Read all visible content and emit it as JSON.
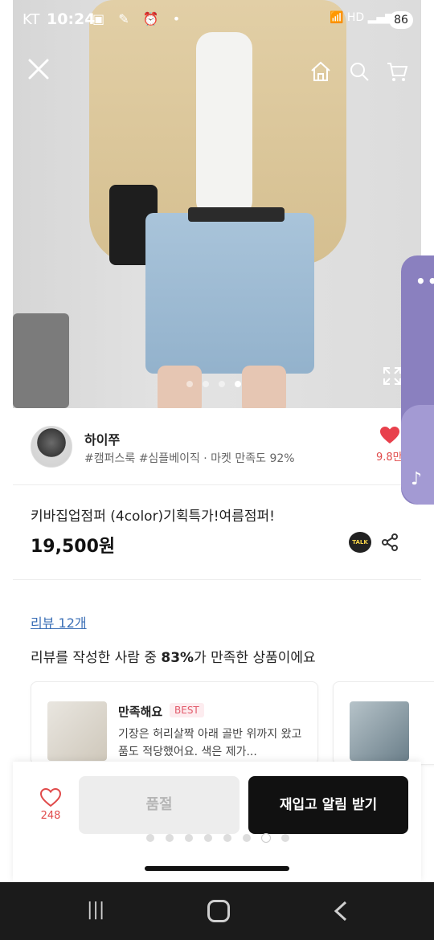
{
  "status_bar": {
    "carrier": "KT",
    "time": "10:24",
    "battery": "86"
  },
  "hero": {
    "image_desc": "product-photo",
    "pager": {
      "total": 4,
      "active": 4
    }
  },
  "seller": {
    "name": "하이쭈",
    "tags": "#캠퍼스룩 #심플베이직 · 마켓 만족도 92%",
    "likes": "9.8만"
  },
  "product": {
    "title": "키바집업점퍼 (4color)기획특가!여름점퍼!",
    "price": "19,500원",
    "talk_label": "TALK"
  },
  "reviews": {
    "link": "리뷰 12개",
    "summary_prefix": "리뷰를 작성한 사람 중 ",
    "summary_percent": "83%",
    "summary_suffix": "가 만족한 상품이에요",
    "cards": [
      {
        "head": "만족해요",
        "badge": "BEST",
        "text": "기장은 허리살짝 아래 골반 위까지 왔고 품도 적당했어요. 색은 제가..."
      }
    ]
  },
  "bottom_bar": {
    "wish_count": "248",
    "soldout_label": "품절",
    "restock_label": "재입고 알림 받기",
    "pager": {
      "total": 8,
      "active": 7
    }
  },
  "colors": {
    "accent_red": "#e04a4a",
    "primary_dark": "#111111",
    "link_blue": "#3b6fb6",
    "widget_purple": "#8a80bf"
  }
}
